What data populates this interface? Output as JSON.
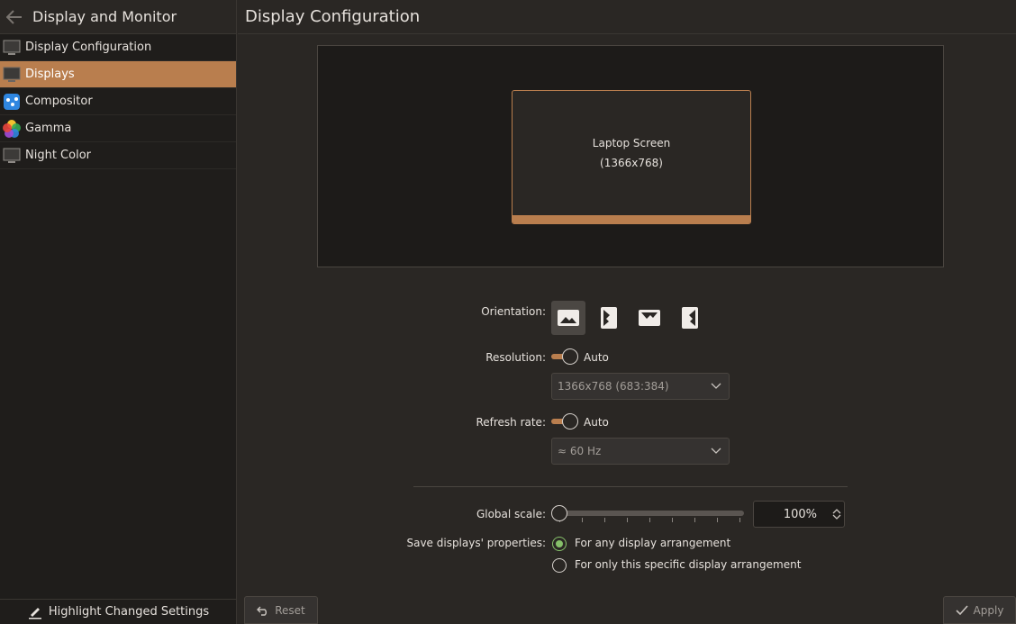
{
  "sidebar": {
    "title": "Display and Monitor",
    "items": [
      {
        "label": "Display Configuration",
        "icon": "monitor-icon",
        "active": false
      },
      {
        "label": "Displays",
        "icon": "monitor-icon",
        "active": true
      },
      {
        "label": "Compositor",
        "icon": "compositor-icon",
        "active": false
      },
      {
        "label": "Gamma",
        "icon": "gamma-icon",
        "active": false
      },
      {
        "label": "Night Color",
        "icon": "monitor-icon",
        "active": false
      }
    ],
    "footer_label": "Highlight Changed Settings"
  },
  "main": {
    "title": "Display Configuration",
    "preview": {
      "screen_name": "Laptop Screen",
      "screen_resolution": "(1366x768)"
    },
    "orientation": {
      "label": "Orientation:",
      "options": [
        "landscape",
        "portrait",
        "landscape-flipped",
        "portrait-flipped"
      ],
      "selected": "landscape"
    },
    "resolution": {
      "label": "Resolution:",
      "auto_label": "Auto",
      "auto_enabled": true,
      "value": "1366x768 (683:384)"
    },
    "refresh_rate": {
      "label": "Refresh rate:",
      "auto_label": "Auto",
      "auto_enabled": true,
      "value": "≈ 60 Hz"
    },
    "global_scale": {
      "label": "Global scale:",
      "value": "100%",
      "slider_fraction": 0
    },
    "save_props": {
      "label": "Save displays' properties:",
      "options": [
        {
          "label": "For any display arrangement",
          "checked": true
        },
        {
          "label": "For only this specific display arrangement",
          "checked": false
        }
      ]
    },
    "buttons": {
      "reset": "Reset",
      "apply": "Apply"
    }
  },
  "colors": {
    "accent": "#b97e4e",
    "radio_checked": "#86c06a",
    "window_bg": "#2a2724",
    "sidebar_bg": "#1f1d1b"
  }
}
